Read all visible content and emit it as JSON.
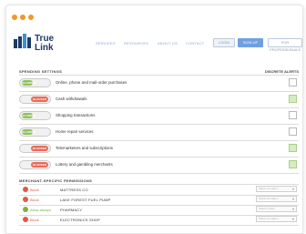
{
  "header": {
    "logo": {
      "line1": "True",
      "line2": "Link"
    },
    "nav": [
      "SERVICES",
      "RESOURCES",
      "ABOUT US",
      "CONTACT"
    ],
    "buttons": [
      "LOGIN",
      "SIGN UP",
      "FOR PROFESSIONALS"
    ]
  },
  "settings": {
    "section_title": "SPENDING SETTINGS",
    "column_title": "DISCRETE ALERTS",
    "items": [
      {
        "state": "on",
        "toggle_label": "ALLOWED",
        "label": "Online, phone and mail-order purchases",
        "alert_checked": false
      },
      {
        "state": "off",
        "toggle_label": "BLOCKED",
        "label": "Cash withdrawals",
        "alert_checked": true
      },
      {
        "state": "on",
        "toggle_label": "ALLOWED",
        "label": "Shopping transactions",
        "alert_checked": false
      },
      {
        "state": "on",
        "toggle_label": "ALLOWED",
        "label": "Home repair services",
        "alert_checked": false
      },
      {
        "state": "off",
        "toggle_label": "BLOCKED",
        "label": "Telemarketers and subscriptions",
        "alert_checked": true
      },
      {
        "state": "off",
        "toggle_label": "BLOCKED",
        "label": "Lottery and gambling merchants",
        "alert_checked": true
      }
    ]
  },
  "merchants": {
    "section_title": "MERCHANT-SPECIFIC PERMISSIONS",
    "items": [
      {
        "status": "Block",
        "color": "red",
        "name": "MATTRESS CO",
        "select": "Select an option"
      },
      {
        "status": "Block",
        "color": "red",
        "name": "LAKE FOREST FUEL PUMP",
        "select": "Select an option"
      },
      {
        "status": "Allow always",
        "color": "green",
        "name": "PHARMACY",
        "select": "Select a date"
      },
      {
        "status": "Block",
        "color": "red",
        "name": "ELECTRONICS SHOP",
        "select": "Select an option"
      }
    ]
  }
}
